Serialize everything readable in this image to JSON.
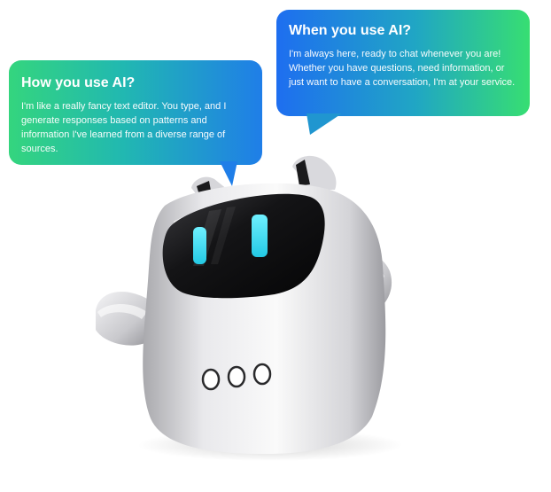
{
  "bubbles": {
    "how": {
      "title": "How you use AI?",
      "body": "I'm like a really fancy text editor. You type, and I generate responses based on patterns and information I've learned from a diverse range of sources."
    },
    "when": {
      "title": "When you use AI?",
      "body": "I'm always here, ready to chat whenever you are! Whether you have questions, need information, or just want to have a conversation, I'm at your service."
    }
  },
  "colors": {
    "bubble_green": "#34d57e",
    "bubble_blue": "#1f7ee8",
    "robot_eye": "#3fe0f2",
    "robot_visor": "#141414",
    "robot_body": "#e6e6e8"
  },
  "icons": {
    "robot": "robot-mascot-illustration"
  }
}
